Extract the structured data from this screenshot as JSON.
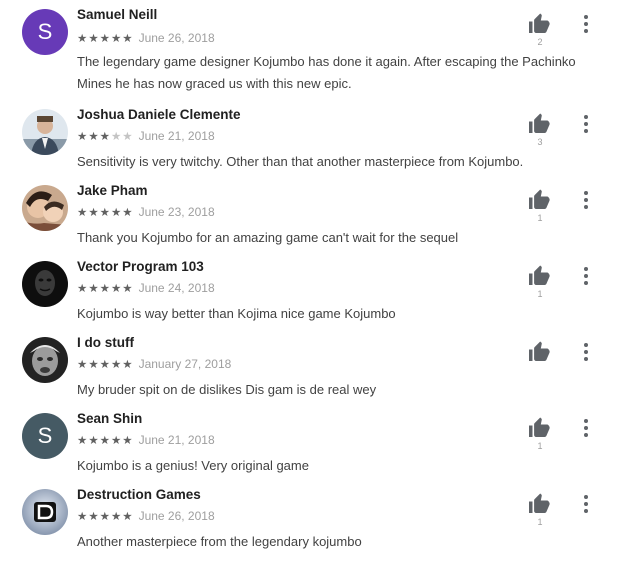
{
  "reviews": [
    {
      "author": "Samuel Neill",
      "avatar": {
        "kind": "letter",
        "letter": "S",
        "color": "#673ab7"
      },
      "stars": 5,
      "date": "June 26, 2018",
      "text": "The legendary game designer Kojumbo has done it again. After escaping the Pachinko Mines he has now graced us with this new epic.",
      "likes": "2"
    },
    {
      "author": "Joshua Daniele Clemente",
      "avatar": {
        "kind": "photo",
        "icon": "person-photo-icon"
      },
      "stars": 3,
      "date": "June 21, 2018",
      "text": "Sensitivity is very twitchy. Other than that another masterpiece from Kojumbo.",
      "likes": "3"
    },
    {
      "author": "Jake Pham",
      "avatar": {
        "kind": "photo",
        "icon": "selfie-photo-icon"
      },
      "stars": 5,
      "date": "June 23, 2018",
      "text": "Thank you Kojumbo for an amazing game can't wait for the sequel",
      "likes": "1"
    },
    {
      "author": "Vector Program 103",
      "avatar": {
        "kind": "photo",
        "icon": "mask-photo-icon"
      },
      "stars": 5,
      "date": "June 24, 2018",
      "text": "Kojumbo is way better than Kojima nice game Kojumbo",
      "likes": "1"
    },
    {
      "author": "I do stuff",
      "avatar": {
        "kind": "photo",
        "icon": "face-photo-icon"
      },
      "stars": 5,
      "date": "January 27, 2018",
      "text": "My bruder spit on de dislikes Dis gam is de real wey",
      "likes": ""
    },
    {
      "author": "Sean Shin",
      "avatar": {
        "kind": "letter",
        "letter": "S",
        "color": "#455a64"
      },
      "stars": 5,
      "date": "June 21, 2018",
      "text": "Kojumbo is a genius! Very original game",
      "likes": "1"
    },
    {
      "author": "Destruction Games",
      "avatar": {
        "kind": "photo",
        "icon": "logo-photo-icon"
      },
      "stars": 5,
      "date": "June 26, 2018",
      "text": "Another masterpiece from the legendary kojumbo",
      "likes": "1"
    }
  ]
}
